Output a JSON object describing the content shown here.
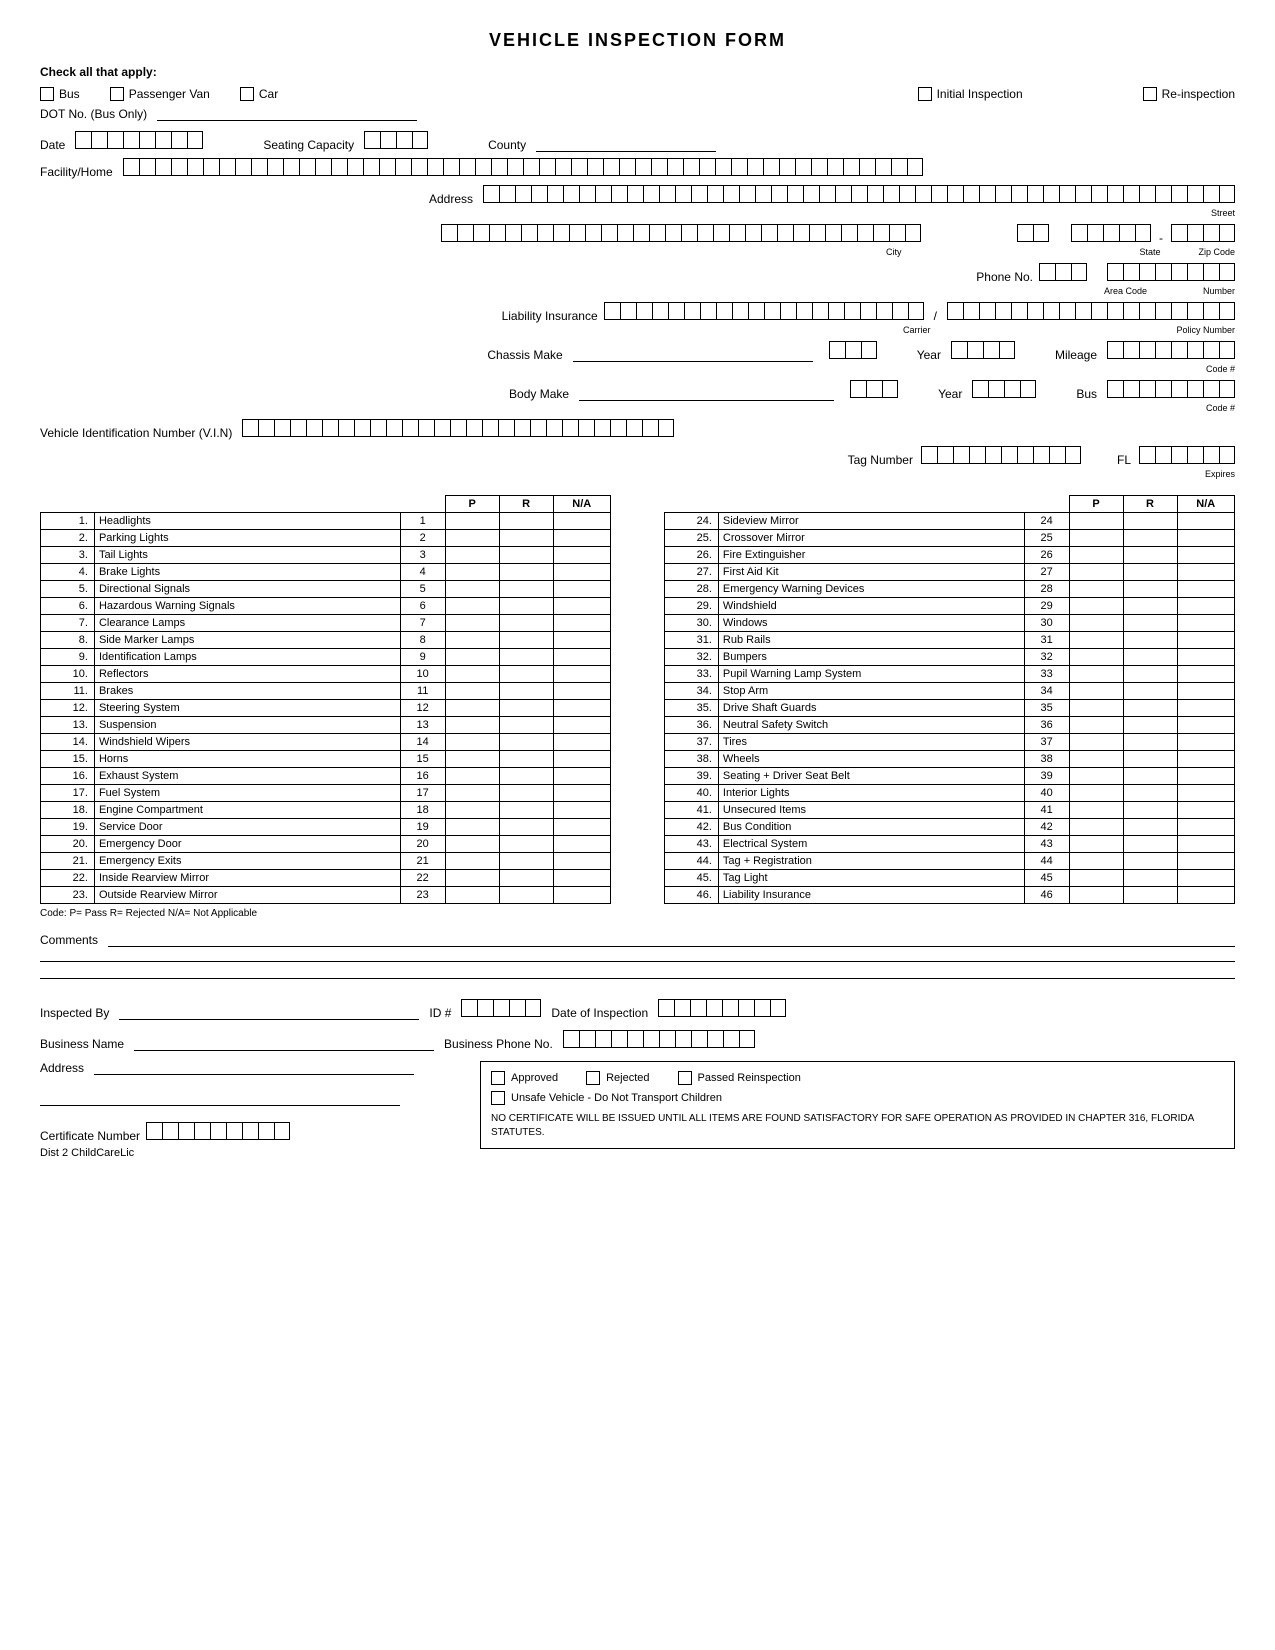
{
  "title": "VEHICLE INSPECTION FORM",
  "check_label": "Check all that apply:",
  "vehicle_types": [
    "Bus",
    "Passenger Van",
    "Car",
    "Initial Inspection",
    "Re-inspection"
  ],
  "dot_label": "DOT No. (Bus Only)",
  "date_label": "Date",
  "seating_label": "Seating Capacity",
  "county_label": "County",
  "facility_label": "Facility/Home",
  "address_label": "Address",
  "street_label": "Street",
  "city_label": "City",
  "state_label": "State",
  "zip_label": "Zip Code",
  "phone_label": "Phone No.",
  "area_code_label": "Area Code",
  "number_label": "Number",
  "liability_label": "Liability Insurance",
  "carrier_label": "Carrier",
  "policy_label": "Policy Number",
  "chassis_label": "Chassis Make",
  "code_hash_label": "Code #",
  "year_label": "Year",
  "mileage_label": "Mileage",
  "body_label": "Body Make",
  "bus_label": "Bus",
  "vin_label": "Vehicle Identification Number (V.I.N)",
  "tag_label": "Tag Number",
  "fl_label": "FL",
  "expires_label": "Expires",
  "col_p": "P",
  "col_r": "R",
  "col_na": "N/A",
  "items_left": [
    {
      "num": "1.",
      "name": "Headlights",
      "seq": "1"
    },
    {
      "num": "2.",
      "name": "Parking Lights",
      "seq": "2"
    },
    {
      "num": "3.",
      "name": "Tail Lights",
      "seq": "3"
    },
    {
      "num": "4.",
      "name": "Brake Lights",
      "seq": "4"
    },
    {
      "num": "5.",
      "name": "Directional Signals",
      "seq": "5"
    },
    {
      "num": "6.",
      "name": "Hazardous Warning Signals",
      "seq": "6"
    },
    {
      "num": "7.",
      "name": "Clearance Lamps",
      "seq": "7"
    },
    {
      "num": "8.",
      "name": "Side Marker Lamps",
      "seq": "8"
    },
    {
      "num": "9.",
      "name": "Identification Lamps",
      "seq": "9"
    },
    {
      "num": "10.",
      "name": "Reflectors",
      "seq": "10"
    },
    {
      "num": "11.",
      "name": "Brakes",
      "seq": "11"
    },
    {
      "num": "12.",
      "name": "Steering System",
      "seq": "12"
    },
    {
      "num": "13.",
      "name": "Suspension",
      "seq": "13"
    },
    {
      "num": "14.",
      "name": "Windshield Wipers",
      "seq": "14"
    },
    {
      "num": "15.",
      "name": "Horns",
      "seq": "15"
    },
    {
      "num": "16.",
      "name": "Exhaust System",
      "seq": "16"
    },
    {
      "num": "17.",
      "name": "Fuel System",
      "seq": "17"
    },
    {
      "num": "18.",
      "name": "Engine Compartment",
      "seq": "18"
    },
    {
      "num": "19.",
      "name": "Service Door",
      "seq": "19"
    },
    {
      "num": "20.",
      "name": "Emergency Door",
      "seq": "20"
    },
    {
      "num": "21.",
      "name": "Emergency Exits",
      "seq": "21"
    },
    {
      "num": "22.",
      "name": "Inside Rearview Mirror",
      "seq": "22"
    },
    {
      "num": "23.",
      "name": "Outside Rearview Mirror",
      "seq": "23"
    }
  ],
  "items_right": [
    {
      "num": "24.",
      "name": "Sideview Mirror",
      "seq": "24"
    },
    {
      "num": "25.",
      "name": "Crossover Mirror",
      "seq": "25"
    },
    {
      "num": "26.",
      "name": "Fire Extinguisher",
      "seq": "26"
    },
    {
      "num": "27.",
      "name": "First Aid Kit",
      "seq": "27"
    },
    {
      "num": "28.",
      "name": "Emergency Warning Devices",
      "seq": "28"
    },
    {
      "num": "29.",
      "name": "Windshield",
      "seq": "29"
    },
    {
      "num": "30.",
      "name": "Windows",
      "seq": "30"
    },
    {
      "num": "31.",
      "name": "Rub Rails",
      "seq": "31"
    },
    {
      "num": "32.",
      "name": "Bumpers",
      "seq": "32"
    },
    {
      "num": "33.",
      "name": "Pupil Warning Lamp System",
      "seq": "33"
    },
    {
      "num": "34.",
      "name": "Stop Arm",
      "seq": "34"
    },
    {
      "num": "35.",
      "name": "Drive Shaft Guards",
      "seq": "35"
    },
    {
      "num": "36.",
      "name": "Neutral Safety Switch",
      "seq": "36"
    },
    {
      "num": "37.",
      "name": "Tires",
      "seq": "37"
    },
    {
      "num": "38.",
      "name": "Wheels",
      "seq": "38"
    },
    {
      "num": "39.",
      "name": "Seating + Driver Seat Belt",
      "seq": "39"
    },
    {
      "num": "40.",
      "name": "Interior Lights",
      "seq": "40"
    },
    {
      "num": "41.",
      "name": "Unsecured Items",
      "seq": "41"
    },
    {
      "num": "42.",
      "name": "Bus Condition",
      "seq": "42"
    },
    {
      "num": "43.",
      "name": "Electrical System",
      "seq": "43"
    },
    {
      "num": "44.",
      "name": "Tag + Registration",
      "seq": "44"
    },
    {
      "num": "45.",
      "name": "Tag Light",
      "seq": "45"
    },
    {
      "num": "46.",
      "name": "Liability Insurance",
      "seq": "46"
    }
  ],
  "code_legend": "Code:  P= Pass  R= Rejected  N/A= Not Applicable",
  "comments_label": "Comments",
  "inspected_by_label": "Inspected By",
  "id_hash_label": "ID #",
  "date_of_inspection_label": "Date of Inspection",
  "business_name_label": "Business Name",
  "business_phone_label": "Business Phone No.",
  "address_bottom_label": "Address",
  "approved_label": "Approved",
  "rejected_label": "Rejected",
  "passed_reinspection_label": "Passed Reinspection",
  "unsafe_label": "Unsafe Vehicle - Do Not Transport Children",
  "certificate_text": "NO CERTIFICATE WILL BE ISSUED UNTIL ALL ITEMS ARE FOUND SATISFACTORY FOR SAFE OPERATION AS PROVIDED IN CHAPTER 316, FLORIDA STATUTES.",
  "certificate_number_label": "Certificate Number",
  "dist_label": "Dist 2  ChildCareLic"
}
